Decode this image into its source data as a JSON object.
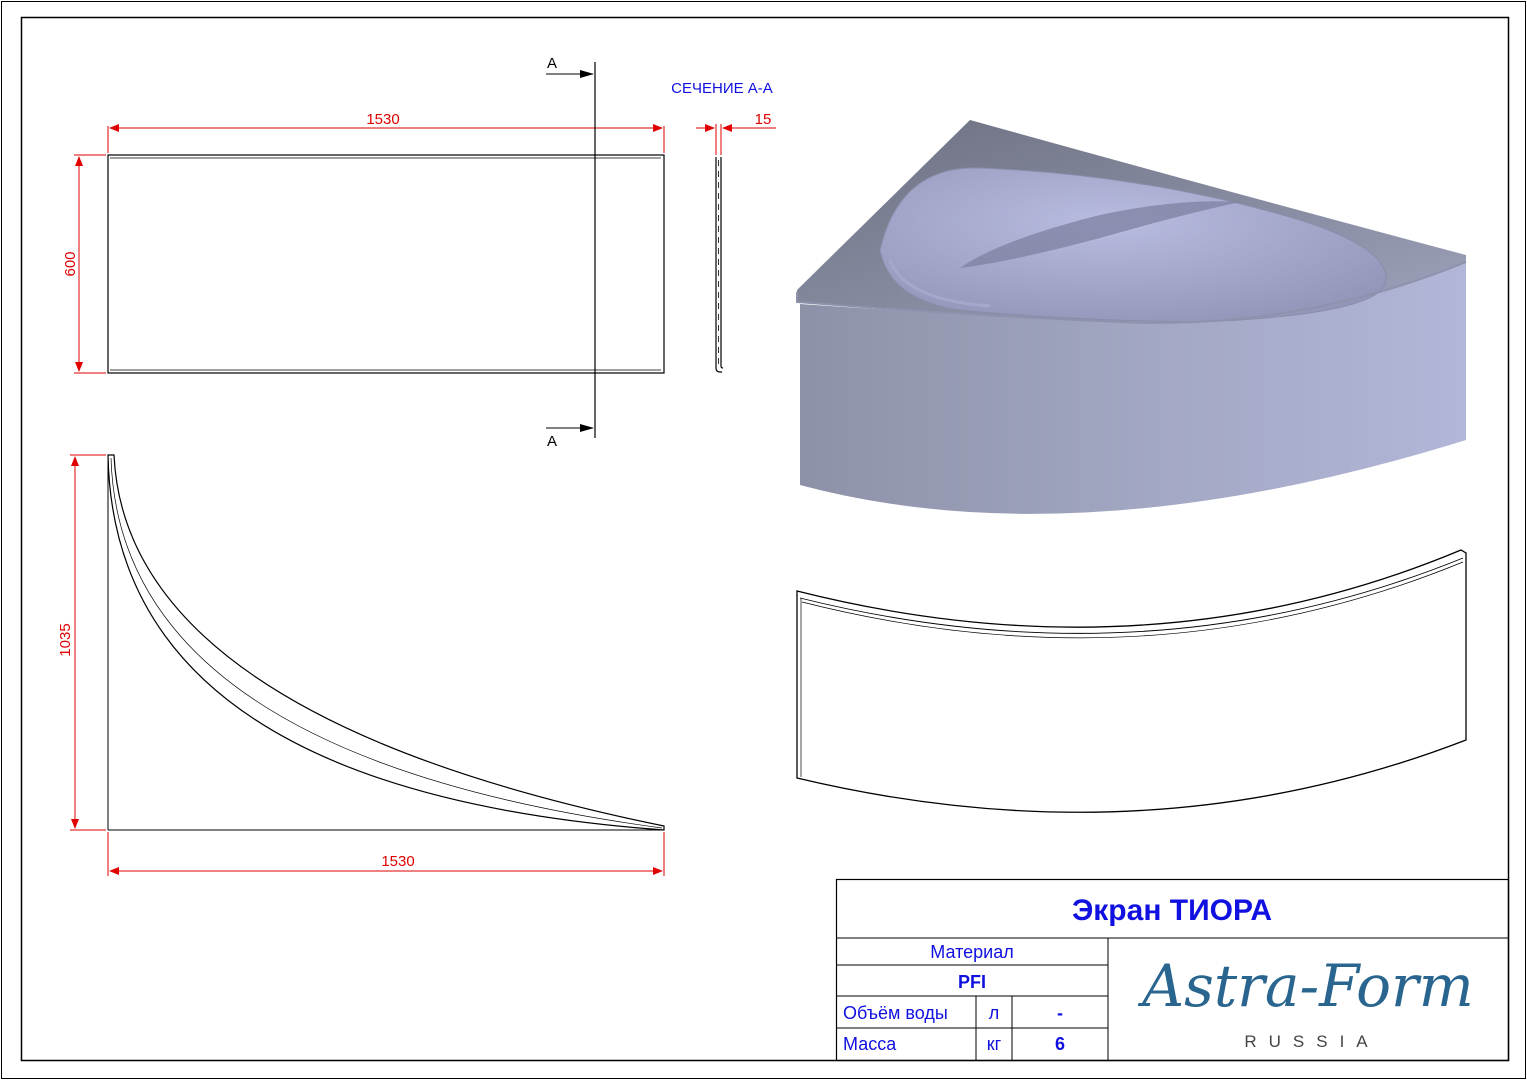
{
  "section_label": "СЕЧЕНИЕ А-А",
  "cut_marker_top": "A",
  "cut_marker_bottom": "A",
  "dimensions": {
    "front_width": "1530",
    "front_height": "600",
    "section_thickness": "15",
    "plan_depth": "1035",
    "plan_width": "1530"
  },
  "title_block": {
    "title": "Экран ТИОРА",
    "material_label": "Материал",
    "material_value": "PFI",
    "rows": [
      {
        "label": "Объём воды",
        "unit": "л",
        "value": "-"
      },
      {
        "label": "Масса",
        "unit": "кг",
        "value": "6"
      }
    ]
  },
  "logo": {
    "name": "Astra-Form",
    "sub": "RUSSIA"
  },
  "colors": {
    "dimension": "#e00000",
    "text": "#1010e0",
    "logo": "#2a6590",
    "render": "#a9adc6"
  }
}
